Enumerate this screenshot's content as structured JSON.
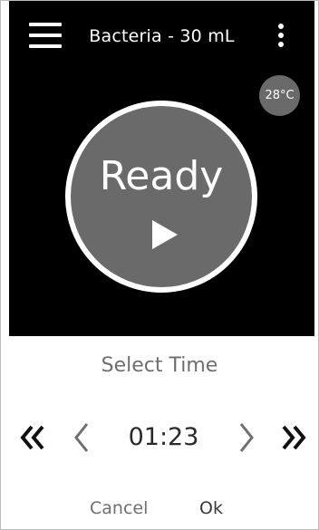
{
  "header": {
    "title": "Bacteria - 30 mL",
    "menu_icon": "hamburger-menu-icon",
    "more_icon": "vertical-dots-icon"
  },
  "status": {
    "temperature": "28°C",
    "state_label": "Ready",
    "play_icon": "play-icon"
  },
  "time_picker": {
    "heading": "Select Time",
    "value": "01:23",
    "fast_back_icon": "double-chevron-left-icon",
    "back_icon": "chevron-left-icon",
    "forward_icon": "chevron-right-icon",
    "fast_forward_icon": "double-chevron-right-icon"
  },
  "actions": {
    "cancel_label": "Cancel",
    "ok_label": "Ok"
  },
  "colors": {
    "background_dark": "#000000",
    "circle_fill": "#6a6a6a",
    "text_muted": "#6f6f6f",
    "text_dark": "#2a2a2a"
  }
}
